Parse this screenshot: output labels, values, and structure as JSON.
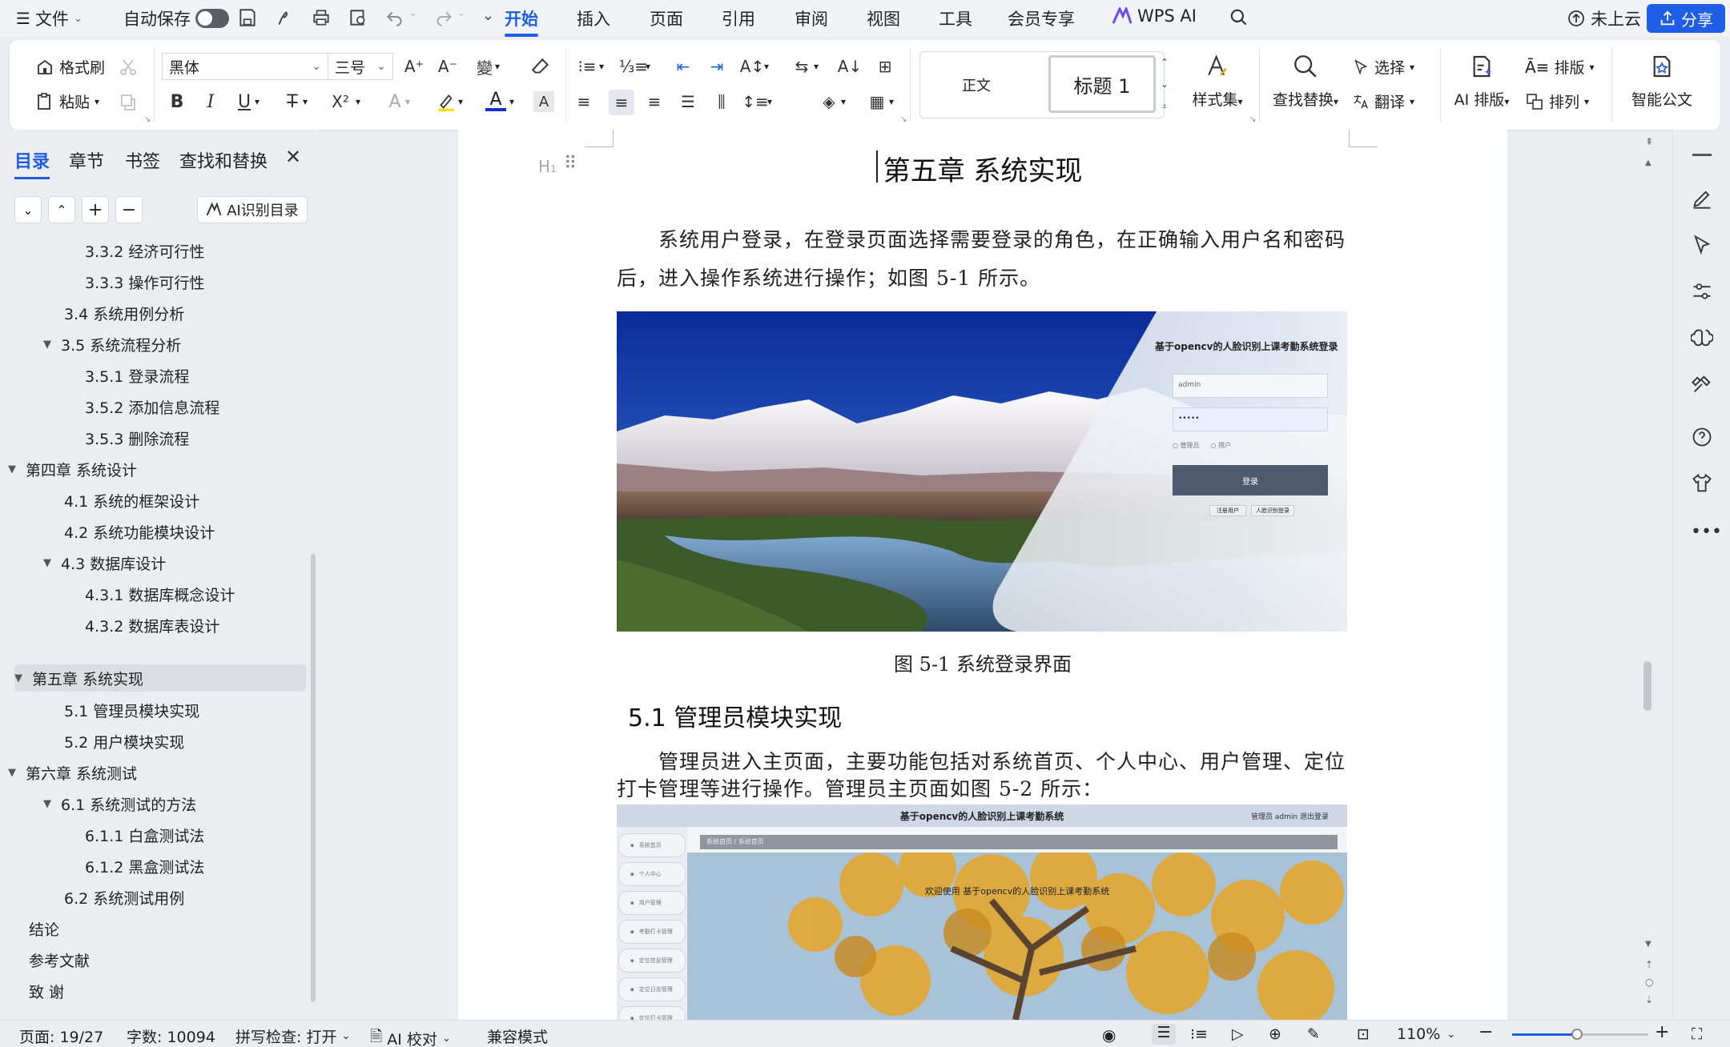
{
  "menubar": {
    "file": "文件",
    "autosave": "自动保存",
    "tabs": [
      "开始",
      "插入",
      "页面",
      "引用",
      "审阅",
      "视图",
      "工具",
      "会员专享"
    ],
    "wps_ai": "WPS AI",
    "cloud": "未上云",
    "share": "分享"
  },
  "ribbon": {
    "format_painter": "格式刷",
    "paste": "粘贴",
    "font_name": "黑体",
    "font_size": "三号",
    "style_normal": "正文",
    "style_heading": "标题 1",
    "style_set": "样式集",
    "find_replace": "查找替换",
    "select": "选择",
    "translate": "翻译",
    "ai_layout": "AI 排版",
    "arrange": "排版",
    "order": "排列",
    "smart_doc": "智能公文"
  },
  "nav": {
    "tabs": [
      "目录",
      "章节",
      "书签",
      "查找和替换"
    ],
    "ai_toc": "AI识别目录",
    "items": [
      {
        "level": 3,
        "text": "3.3.2  经济可行性",
        "caret": ""
      },
      {
        "level": 3,
        "text": "3.3.3  操作可行性",
        "caret": ""
      },
      {
        "level": 2,
        "text": "3.4  系统用例分析",
        "caret": ""
      },
      {
        "level": 2,
        "text": "3.5  系统流程分析",
        "caret": "▼"
      },
      {
        "level": 3,
        "text": "3.5.1  登录流程",
        "caret": ""
      },
      {
        "level": 3,
        "text": "3.5.2  添加信息流程",
        "caret": ""
      },
      {
        "level": 3,
        "text": "3.5.3  删除流程",
        "caret": ""
      },
      {
        "level": 1,
        "text": "第四章  系统设计",
        "caret": "▼"
      },
      {
        "level": 2,
        "text": "4.1 系统的框架设计",
        "caret": ""
      },
      {
        "level": 2,
        "text": "4.2 系统功能模块设计",
        "caret": ""
      },
      {
        "level": 2,
        "text": "4.3  数据库设计",
        "caret": "▼"
      },
      {
        "level": 3,
        "text": "4.3.1 数据库概念设计",
        "caret": ""
      },
      {
        "level": 3,
        "text": "4.3.2  数据库表设计",
        "caret": ""
      },
      {
        "level": 1,
        "text": "第五章  系统实现",
        "caret": "▼"
      },
      {
        "level": 2,
        "text": "5.1 管理员模块实现",
        "caret": ""
      },
      {
        "level": 2,
        "text": "5.2 用户模块实现",
        "caret": ""
      },
      {
        "level": 1,
        "text": "第六章  系统测试",
        "caret": "▼"
      },
      {
        "level": 2,
        "text": "6.1 系统测试的方法",
        "caret": "▼"
      },
      {
        "level": 3,
        "text": "6.1.1 白盒测试法",
        "caret": ""
      },
      {
        "level": 3,
        "text": "6.1.2 黑盒测试法",
        "caret": ""
      },
      {
        "level": 2,
        "text": "6.2 系统测试用例",
        "caret": ""
      },
      {
        "level": 1,
        "text": "结论",
        "caret": ""
      },
      {
        "level": 1,
        "text": "参考文献",
        "caret": ""
      },
      {
        "level": 1,
        "text": "致      谢",
        "caret": ""
      }
    ]
  },
  "doc": {
    "chapter_title": "第五章  系统实现",
    "para1_line1": "系统用户登录，在登录页面选择需要登录的角色，在正确输入用户名和密码",
    "para1_line2": "后，进入操作系统进行操作；如图 5-1 所示。",
    "fig1": {
      "title": "基于opencv的人脸识别上课考勤系统登录",
      "username": "admin",
      "password": "•••••",
      "role_admin": "管理员",
      "role_user": "用户",
      "login": "登录",
      "register": "注册用户",
      "face_login": "人脸识别登录"
    },
    "fig1_caption": "图 5-1 系统登录界面",
    "section_title": "5.1 管理员模块实现",
    "para2_line1": "管理员进入主页面，主要功能包括对系统首页、个人中心、用户管理、定位",
    "para2_line2": "打卡管理等进行操作。管理员主页面如图 5-2 所示：",
    "fig2": {
      "header": "基于opencv的人脸识别上课考勤系统",
      "user": "管理员 admin  退出登录",
      "breadcrumb": "系统首页  /  系统首页",
      "welcome": "欢迎使用 基于opencv的人脸识别上课考勤系统",
      "menu": [
        "系统首页",
        "个人中心",
        "用户管理",
        "考勤打卡管理",
        "定位信息管理",
        "定位日志管理",
        "定位打卡管理"
      ]
    }
  },
  "status": {
    "page": "页面: 19/27",
    "words": "字数: 10094",
    "spell": "拼写检查: 打开",
    "ai_check": "AI 校对",
    "compat": "兼容模式",
    "zoom": "110%"
  },
  "colors": {
    "accent": "#1e5ee6",
    "login_button": "#4e5a6e"
  }
}
